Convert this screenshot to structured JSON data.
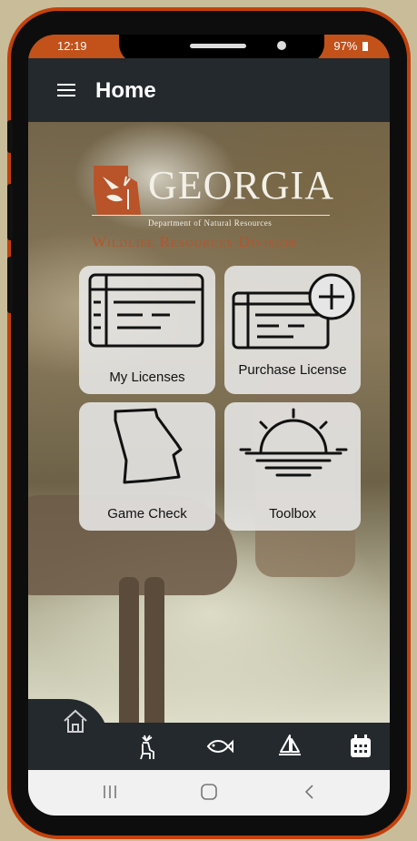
{
  "status_bar": {
    "time": "12:19",
    "battery": "97%"
  },
  "app_bar": {
    "title": "Home"
  },
  "logo": {
    "title": "GEORGIA",
    "subtitle": "Department of Natural Resources",
    "division": "Wildlife Resources Division"
  },
  "tiles": [
    {
      "label": "My Licenses",
      "icon": "license-card-icon"
    },
    {
      "label": "Purchase License",
      "icon": "add-license-icon"
    },
    {
      "label": "Game Check",
      "icon": "georgia-map-icon"
    },
    {
      "label": "Toolbox",
      "icon": "sunrise-icon"
    }
  ],
  "bottom_nav": [
    "home-icon",
    "deer-icon",
    "fish-icon",
    "boat-icon",
    "calendar-icon"
  ],
  "system_nav": [
    "recent-apps-icon",
    "home-circle-icon",
    "back-icon"
  ],
  "colors": {
    "accent": "#c2511a",
    "app_bar": "#23292d",
    "tile": "#ebebeb"
  }
}
